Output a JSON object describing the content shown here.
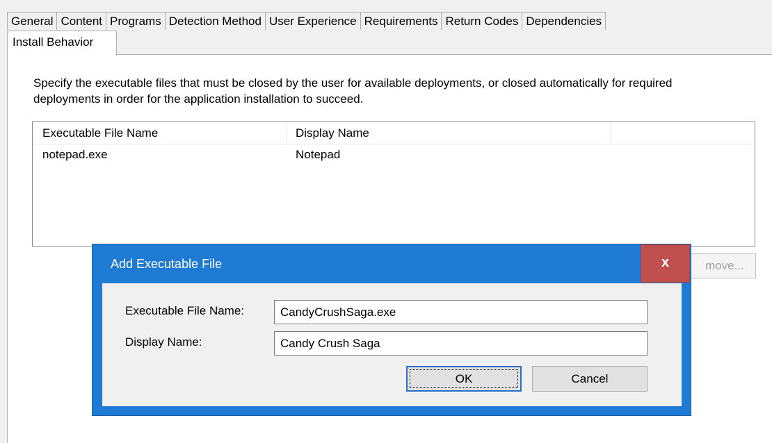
{
  "tabs": [
    "General",
    "Content",
    "Programs",
    "Detection Method",
    "User Experience",
    "Requirements",
    "Return Codes",
    "Dependencies"
  ],
  "active_tab": "Install Behavior",
  "description": "Specify the executable files that must be closed by the user for available deployments, or closed automatically for required deployments in order for the application installation to succeed.",
  "list": {
    "columns": [
      "Executable File Name",
      "Display Name"
    ],
    "rows": [
      {
        "exe": "notepad.exe",
        "display": "Notepad"
      }
    ]
  },
  "remove_button_partial": "move...",
  "dialog": {
    "title": "Add Executable File",
    "close_glyph": "x",
    "exe_label": "Executable File Name:",
    "exe_value": "CandyCrushSaga.exe",
    "display_label": "Display Name:",
    "display_value": "Candy Crush Saga",
    "ok_label": "OK",
    "cancel_label": "Cancel"
  }
}
